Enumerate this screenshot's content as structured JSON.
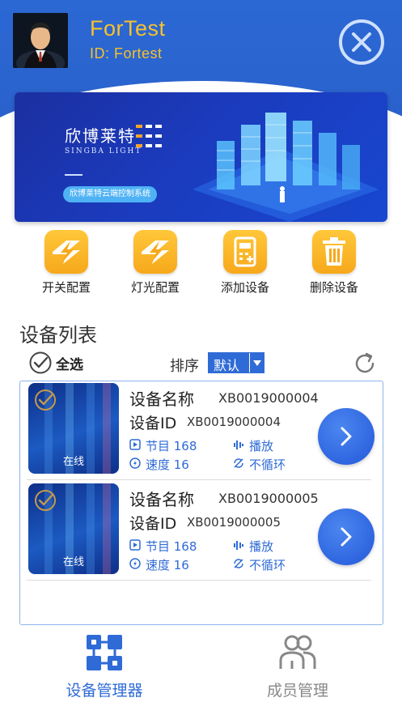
{
  "header": {
    "title": "ForTest",
    "user_id": "ID: Fortest",
    "avatar_icon": "user-avatar-icon",
    "close_icon": "close-icon",
    "accent_color": "#f7c12c",
    "bg_color": "#2b68d4"
  },
  "banner": {
    "brand": "欣博莱特",
    "brand_en": "SINGBA LIGHT",
    "tag": "欣博莱特云端控制系统"
  },
  "actions": [
    {
      "label": "开关配置",
      "icon": "lightning-icon"
    },
    {
      "label": "灯光配置",
      "icon": "lightning-icon"
    },
    {
      "label": "添加设备",
      "icon": "device-add-icon"
    },
    {
      "label": "删除设备",
      "icon": "trash-icon"
    }
  ],
  "device_list": {
    "title": "设备列表",
    "select_all": "全选",
    "sort_label": "排序",
    "sort_value": "默认",
    "devices": [
      {
        "name_label": "设备名称",
        "name": "XB0019000004",
        "id_label": "设备ID",
        "id": "XB0019000004",
        "status": "在线",
        "program": "节目 168",
        "speed": "速度 16",
        "play": "播放",
        "loop": "不循环"
      },
      {
        "name_label": "设备名称",
        "name": "XB0019000005",
        "id_label": "设备ID",
        "id": "XB0019000005",
        "status": "在线",
        "program": "节目 168",
        "speed": "速度 16",
        "play": "播放",
        "loop": "不循环"
      }
    ]
  },
  "bottom_nav": {
    "items": [
      {
        "label": "设备管理器",
        "icon": "device-manager-icon",
        "active": true,
        "color": "#2f6bd6"
      },
      {
        "label": "成员管理",
        "icon": "members-icon",
        "active": false,
        "color": "#888888"
      }
    ]
  }
}
